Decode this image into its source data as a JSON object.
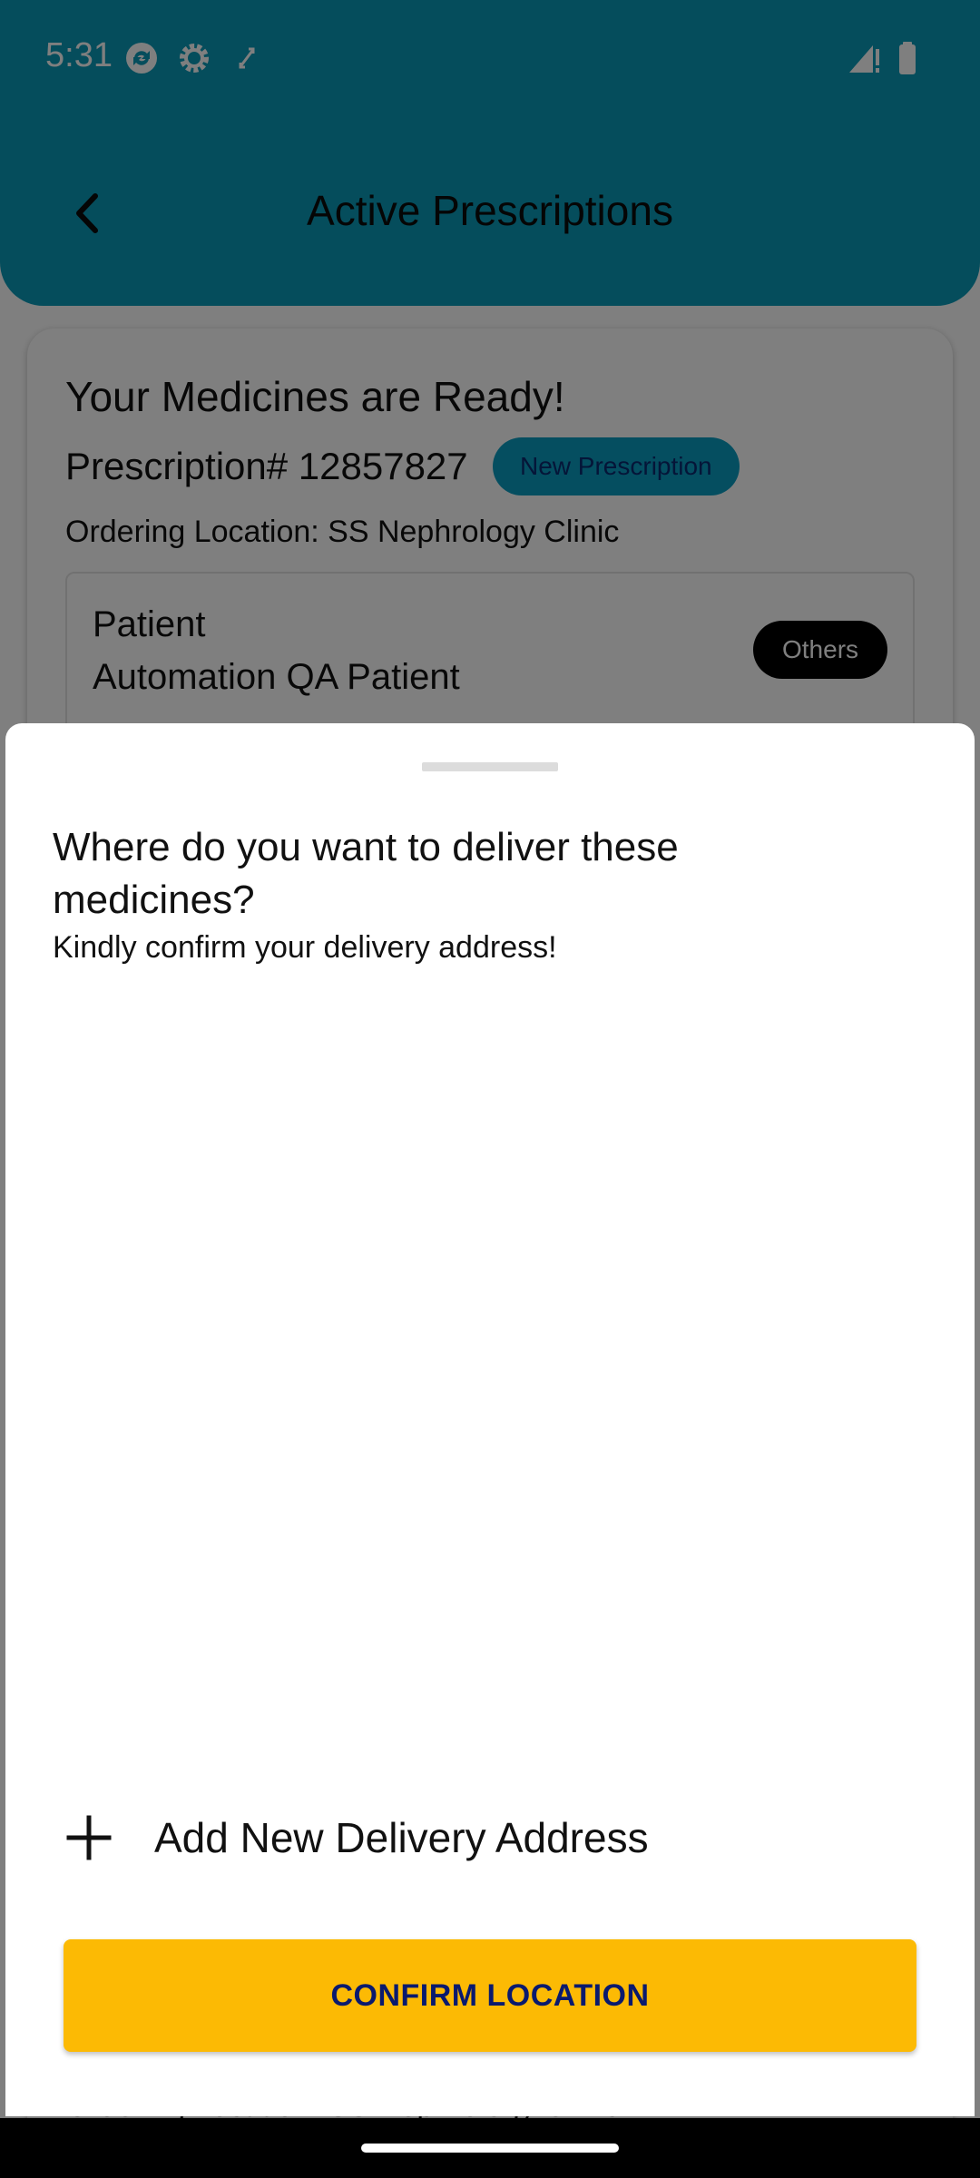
{
  "status_bar": {
    "time": "5:31",
    "icons": [
      "sync-icon",
      "settings-icon",
      "nfc-icon",
      "signal-icon",
      "battery-icon"
    ]
  },
  "header": {
    "title": "Active Prescriptions",
    "back_icon": "chevron-left-icon",
    "color": "#0a9ab8"
  },
  "card": {
    "heading": "Your Medicines are Ready!",
    "prescription_number": "Prescription# 12857827",
    "badge": "New Prescription",
    "ordering_location": "Ordering Location: SS Nephrology Clinic",
    "patient_label": "Patient",
    "patient_name": "Automation QA Patient",
    "patient_tag": "Others"
  },
  "sheet": {
    "title": "Where do you want to deliver these medicines?",
    "subtitle": "Kindly confirm your delivery address!",
    "add_address_label": "Add New Delivery Address",
    "confirm_label": "CONFIRM LOCATION",
    "confirm_color": "#fcba04"
  }
}
